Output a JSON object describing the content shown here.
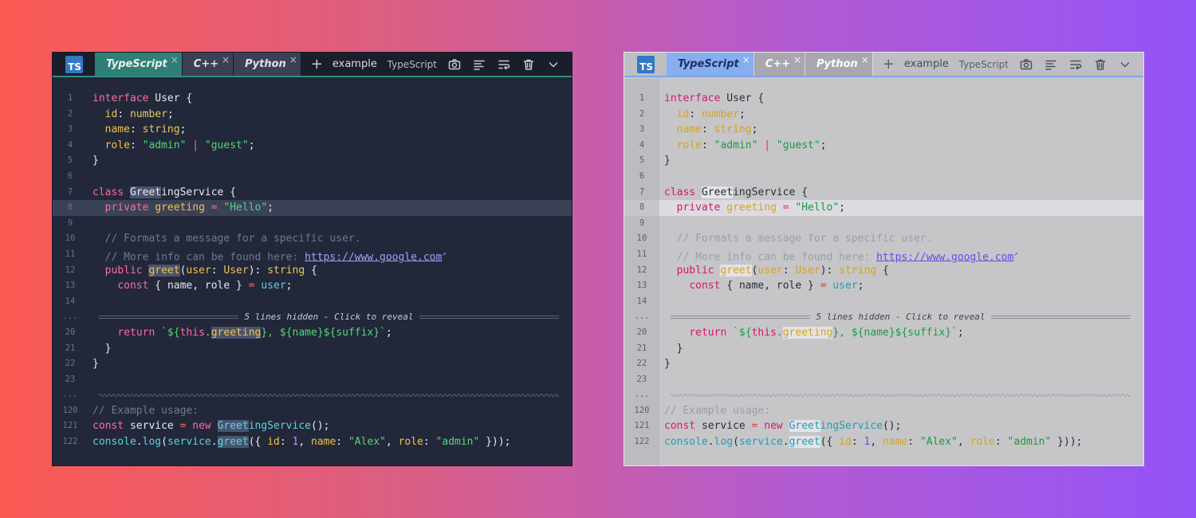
{
  "tabs": [
    {
      "label": "TypeScript",
      "close": "×"
    },
    {
      "label": "C++",
      "close": "×"
    },
    {
      "label": "Python",
      "close": "×"
    }
  ],
  "logo": "TS",
  "add_label": "+",
  "filename": "example",
  "language": "TypeScript",
  "toolbar_icons": [
    "camera-icon",
    "format-icon",
    "wrap-icon",
    "trash-icon",
    "chevron-down-icon"
  ],
  "fold_message": "5 lines hidden - Click to reveal",
  "fold_marker": "...",
  "colors": {
    "dark_bg": "#222839",
    "dark_active_tab": "#2f7f76",
    "light_bg": "#c6c6c9",
    "light_active_tab": "#86aef0"
  },
  "lines": [
    {
      "n": "1",
      "parts": [
        [
          "kw",
          "interface "
        ],
        [
          "id",
          "User "
        ],
        [
          "pun",
          "{"
        ]
      ]
    },
    {
      "n": "2",
      "parts": [
        [
          "pun",
          "  "
        ],
        [
          "prop",
          "id"
        ],
        [
          "pun",
          ": "
        ],
        [
          "ty",
          "number"
        ],
        [
          "pun",
          ";"
        ]
      ]
    },
    {
      "n": "3",
      "parts": [
        [
          "pun",
          "  "
        ],
        [
          "prop",
          "name"
        ],
        [
          "pun",
          ": "
        ],
        [
          "ty",
          "string"
        ],
        [
          "pun",
          ";"
        ]
      ]
    },
    {
      "n": "4",
      "parts": [
        [
          "pun",
          "  "
        ],
        [
          "prop",
          "role"
        ],
        [
          "pun",
          ": "
        ],
        [
          "str",
          "\"admin\""
        ],
        [
          "pun",
          " "
        ],
        [
          "op",
          "|"
        ],
        [
          "pun",
          " "
        ],
        [
          "str",
          "\"guest\""
        ],
        [
          "pun",
          ";"
        ]
      ]
    },
    {
      "n": "5",
      "parts": [
        [
          "pun",
          "}"
        ]
      ]
    },
    {
      "n": "6",
      "parts": []
    },
    {
      "n": "7",
      "parts": [
        [
          "kw",
          "class "
        ],
        [
          "id mark",
          "Greet"
        ],
        [
          "id",
          "ingService "
        ],
        [
          "pun",
          "{"
        ]
      ]
    },
    {
      "n": "8",
      "hl": true,
      "parts": [
        [
          "pun",
          "  "
        ],
        [
          "kw",
          "private "
        ],
        [
          "prop",
          "greeting"
        ],
        [
          "pun",
          " "
        ],
        [
          "op",
          "="
        ],
        [
          "pun",
          " "
        ],
        [
          "str",
          "\"Hello\""
        ],
        [
          "pun",
          ";"
        ]
      ]
    },
    {
      "n": "9",
      "parts": []
    },
    {
      "n": "10",
      "parts": [
        [
          "cm",
          "  // Formats a message for a specific user."
        ]
      ]
    },
    {
      "n": "11",
      "parts": [
        [
          "cm",
          "  // More info can be found here: "
        ],
        [
          "lnk",
          "https://www.google.com"
        ]
      ],
      "ext": true
    },
    {
      "n": "12",
      "parts": [
        [
          "pun",
          "  "
        ],
        [
          "kw",
          "public "
        ],
        [
          "prop mark",
          "greet"
        ],
        [
          "pun",
          "("
        ],
        [
          "prop",
          "user"
        ],
        [
          "pun",
          ": "
        ],
        [
          "ty",
          "User"
        ],
        [
          "pun",
          "): "
        ],
        [
          "ty",
          "string"
        ],
        [
          "pun",
          " {"
        ]
      ]
    },
    {
      "n": "13",
      "parts": [
        [
          "pun",
          "    "
        ],
        [
          "kw",
          "const "
        ],
        [
          "pun",
          "{ "
        ],
        [
          "id",
          "name"
        ],
        [
          "pun",
          ", "
        ],
        [
          "id",
          "role"
        ],
        [
          "pun",
          " } "
        ],
        [
          "op",
          "="
        ],
        [
          "pun",
          " "
        ],
        [
          "cls",
          "user"
        ],
        [
          "pun",
          ";"
        ]
      ]
    },
    {
      "n": "14",
      "parts": []
    },
    {
      "fold": true
    },
    {
      "n": "20",
      "parts": [
        [
          "pun",
          "    "
        ],
        [
          "kw",
          "return "
        ],
        [
          "str",
          "`${"
        ],
        [
          "kw",
          "this"
        ],
        [
          "str",
          "."
        ],
        [
          "prop mark",
          "greeting"
        ],
        [
          "str",
          "}, ${"
        ],
        [
          "str",
          "name"
        ],
        [
          "str",
          "}${"
        ],
        [
          "str",
          "suffix"
        ],
        [
          "str",
          "}`"
        ],
        [
          "pun",
          ";"
        ]
      ]
    },
    {
      "n": "21",
      "parts": [
        [
          "pun",
          "  }"
        ]
      ]
    },
    {
      "n": "22",
      "parts": [
        [
          "pun",
          "}"
        ]
      ]
    },
    {
      "n": "23",
      "parts": []
    },
    {
      "wavy": true
    },
    {
      "n": "120",
      "parts": [
        [
          "cm",
          "// Example usage:"
        ]
      ]
    },
    {
      "n": "121",
      "parts": [
        [
          "kw",
          "const "
        ],
        [
          "id",
          "service "
        ],
        [
          "op",
          "="
        ],
        [
          "pun",
          " "
        ],
        [
          "kw",
          "new "
        ],
        [
          "cls mark",
          "Greet"
        ],
        [
          "cls",
          "ingService"
        ],
        [
          "pun",
          "();"
        ]
      ]
    },
    {
      "n": "122",
      "parts": [
        [
          "cls",
          "console"
        ],
        [
          "pun",
          "."
        ],
        [
          "cls",
          "log"
        ],
        [
          "pun",
          "("
        ],
        [
          "cls",
          "service"
        ],
        [
          "pun",
          "."
        ],
        [
          "cls mark",
          "greet"
        ],
        [
          "pun",
          "({ "
        ],
        [
          "prop",
          "id"
        ],
        [
          "pun",
          ": "
        ],
        [
          "num",
          "1"
        ],
        [
          "pun",
          ", "
        ],
        [
          "prop",
          "name"
        ],
        [
          "pun",
          ": "
        ],
        [
          "str",
          "\"Alex\""
        ],
        [
          "pun",
          ", "
        ],
        [
          "prop",
          "role"
        ],
        [
          "pun",
          ": "
        ],
        [
          "str",
          "\"admin\""
        ],
        [
          "pun",
          " }));"
        ]
      ]
    }
  ]
}
